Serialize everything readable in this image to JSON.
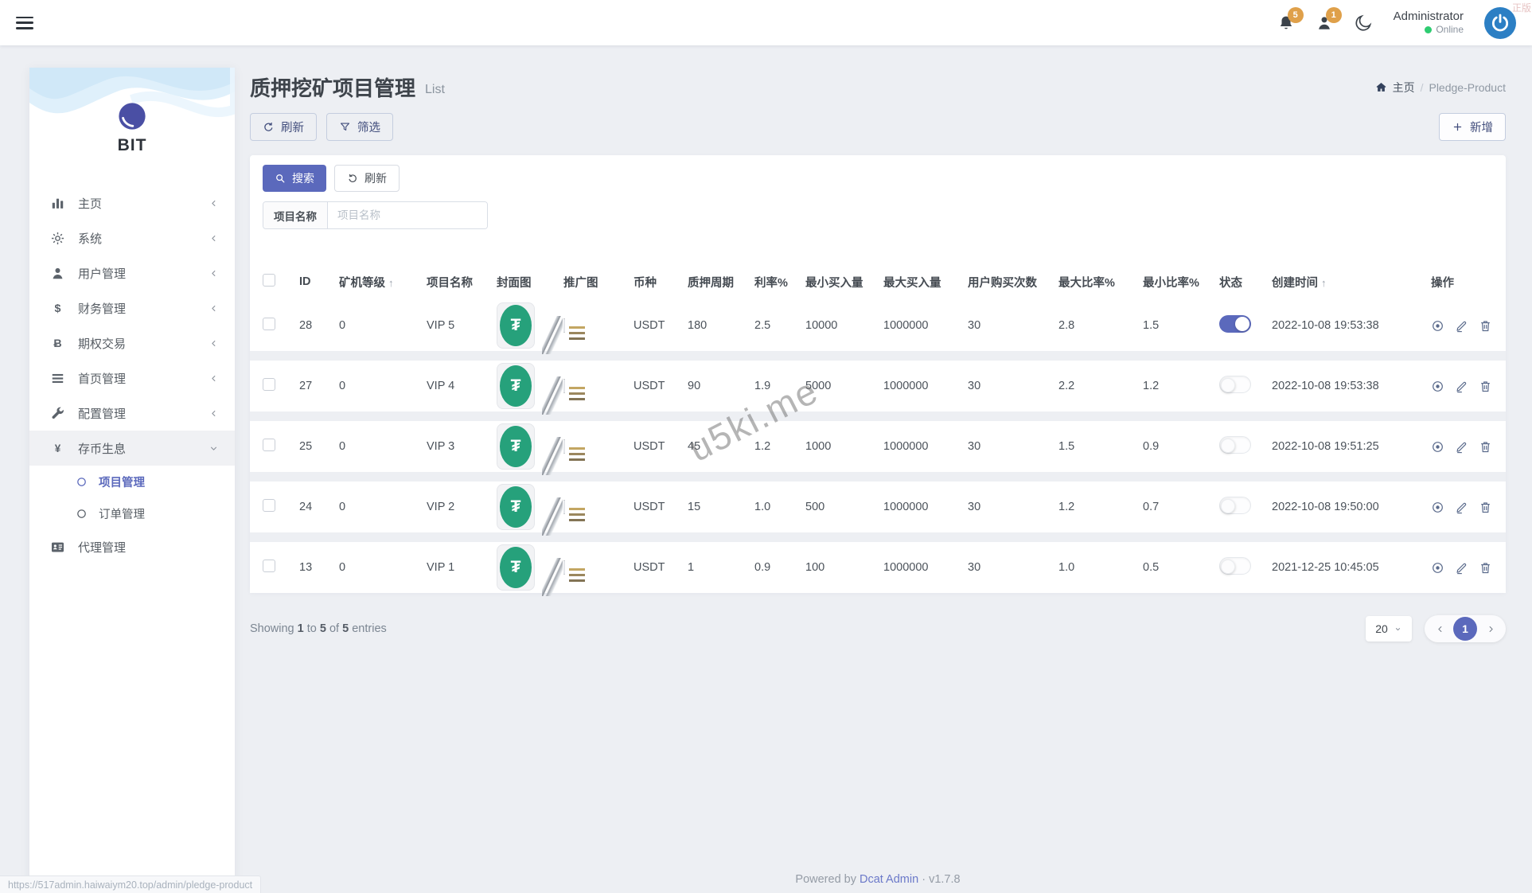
{
  "colors": {
    "primary": "#5b69bc",
    "badge": "#dfa04a",
    "tether_green": "#26a17b",
    "online_green": "#2ecc71"
  },
  "navbar": {
    "badges": [
      {
        "icon": "bell-icon",
        "count": "5"
      },
      {
        "icon": "user-icon",
        "count": "1"
      }
    ],
    "user": {
      "name": "Administrator",
      "status": "Online"
    },
    "corner_mark": "正版"
  },
  "sidebar": {
    "logo_text": "BIT",
    "items": [
      {
        "icon": "chart-bar",
        "label": "主页",
        "chevron": "left"
      },
      {
        "icon": "gear",
        "label": "系统",
        "chevron": "left"
      },
      {
        "icon": "user",
        "label": "用户管理",
        "chevron": "left"
      },
      {
        "icon": "dollar",
        "label": "财务管理",
        "chevron": "left"
      },
      {
        "icon": "bitcoin",
        "label": "期权交易",
        "chevron": "left"
      },
      {
        "icon": "list",
        "label": "首页管理",
        "chevron": "left"
      },
      {
        "icon": "wrench",
        "label": "配置管理",
        "chevron": "left"
      },
      {
        "icon": "yen",
        "label": "存币生息",
        "chevron": "down",
        "active": true,
        "children": [
          {
            "label": "项目管理",
            "active": true
          },
          {
            "label": "订单管理",
            "active": false
          }
        ]
      },
      {
        "icon": "idcard",
        "label": "代理管理"
      }
    ]
  },
  "page": {
    "title": "质押挖矿项目管理",
    "subtitle": "List"
  },
  "breadcrumb": {
    "home": "主页",
    "separator": "/",
    "current": "Pledge-Product"
  },
  "toolbar": {
    "refresh_label": "刷新",
    "filter_label": "筛选",
    "create_label": "新增"
  },
  "filter_panel": {
    "search_label": "搜索",
    "refresh_label": "刷新",
    "field_label": "项目名称",
    "placeholder": "项目名称"
  },
  "table": {
    "headers": [
      {
        "label": "",
        "type": "checkbox"
      },
      {
        "label": "ID"
      },
      {
        "label": "矿机等级",
        "sort": true
      },
      {
        "label": "项目名称"
      },
      {
        "label": "封面图"
      },
      {
        "label": "推广图"
      },
      {
        "label": "币种"
      },
      {
        "label": "质押周期"
      },
      {
        "label": "利率%"
      },
      {
        "label": "最小买入量"
      },
      {
        "label": "最大买入量"
      },
      {
        "label": "用户购买次数"
      },
      {
        "label": "最大比率%"
      },
      {
        "label": "最小比率%"
      },
      {
        "label": "状态"
      },
      {
        "label": "创建时间",
        "sort": true
      },
      {
        "label": "操作"
      }
    ],
    "rows": [
      {
        "id": "28",
        "level": "0",
        "name": "VIP 5",
        "cover": "tether-logo",
        "promo": "black-promo-card",
        "coin": "USDT",
        "period": "180",
        "rate": "2.5",
        "min_buy": "10000",
        "max_buy": "1000000",
        "buy_times": "30",
        "max_ratio": "2.8",
        "min_ratio": "1.5",
        "status_on": true,
        "created": "2022-10-08 19:53:38"
      },
      {
        "id": "27",
        "level": "0",
        "name": "VIP 4",
        "cover": "tether-logo",
        "promo": "black-promo-card",
        "coin": "USDT",
        "period": "90",
        "rate": "1.9",
        "min_buy": "5000",
        "max_buy": "1000000",
        "buy_times": "30",
        "max_ratio": "2.2",
        "min_ratio": "1.2",
        "status_on": false,
        "created": "2022-10-08 19:53:38"
      },
      {
        "id": "25",
        "level": "0",
        "name": "VIP 3",
        "cover": "tether-logo",
        "promo": "black-promo-card",
        "coin": "USDT",
        "period": "45",
        "rate": "1.2",
        "min_buy": "1000",
        "max_buy": "1000000",
        "buy_times": "30",
        "max_ratio": "1.5",
        "min_ratio": "0.9",
        "status_on": false,
        "created": "2022-10-08 19:51:25"
      },
      {
        "id": "24",
        "level": "0",
        "name": "VIP 2",
        "cover": "tether-logo",
        "promo": "black-promo-card",
        "coin": "USDT",
        "period": "15",
        "rate": "1.0",
        "min_buy": "500",
        "max_buy": "1000000",
        "buy_times": "30",
        "max_ratio": "1.2",
        "min_ratio": "0.7",
        "status_on": false,
        "created": "2022-10-08 19:50:00"
      },
      {
        "id": "13",
        "level": "0",
        "name": "VIP 1",
        "cover": "tether-logo",
        "promo": "black-promo-card",
        "coin": "USDT",
        "period": "1",
        "rate": "0.9",
        "min_buy": "100",
        "max_buy": "1000000",
        "buy_times": "30",
        "max_ratio": "1.0",
        "min_ratio": "0.5",
        "status_on": false,
        "created": "2021-12-25 10:45:05"
      }
    ],
    "tether_symbol": "₮"
  },
  "table_footer": {
    "showing_parts": [
      {
        "t": "Showing ",
        "b": false
      },
      {
        "t": "1",
        "b": true
      },
      {
        "t": " to ",
        "b": false
      },
      {
        "t": "5",
        "b": true
      },
      {
        "t": " of ",
        "b": false
      },
      {
        "t": "5",
        "b": true
      },
      {
        "t": " entries",
        "b": false
      }
    ],
    "page_size": "20",
    "current_page": "1"
  },
  "watermark": "u5ki.me",
  "page_footer": {
    "powered": "Powered by ",
    "brand": "Dcat Admin",
    "separator": "·",
    "version": "v1.7.8"
  },
  "status_bar": {
    "url": "https://517admin.haiwaiym20.top/admin/pledge-product"
  }
}
